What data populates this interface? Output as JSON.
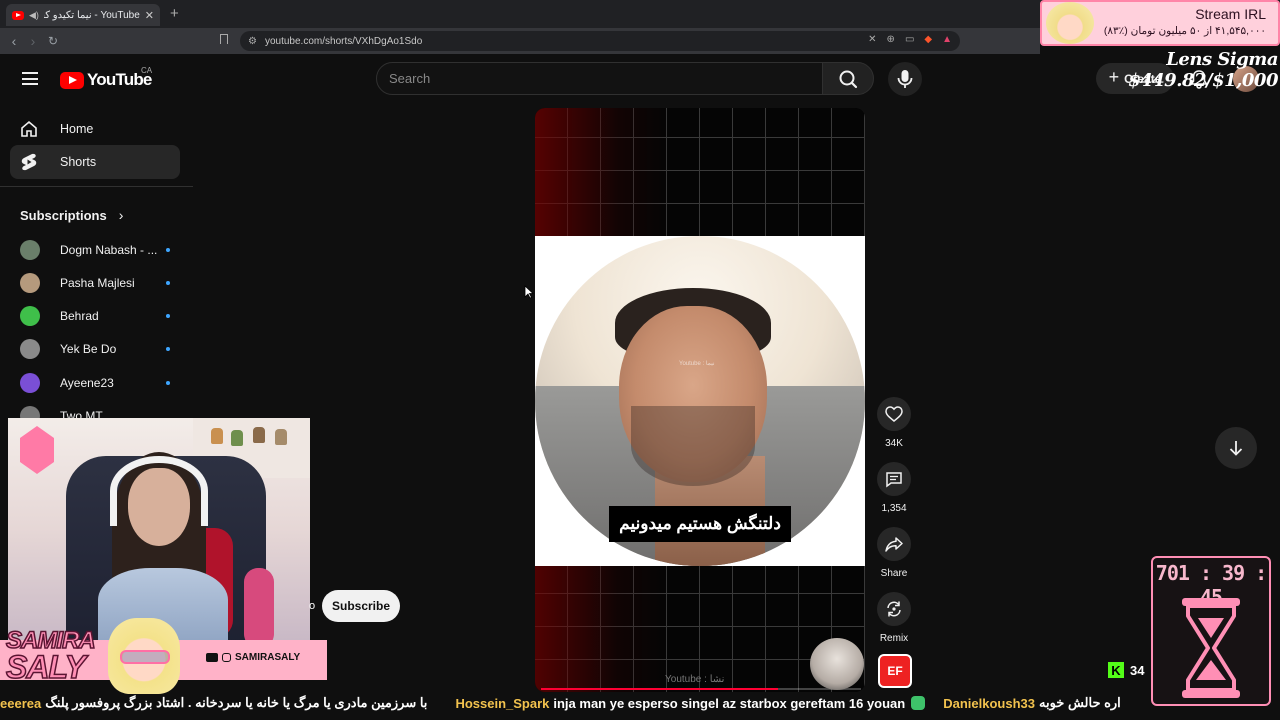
{
  "browser": {
    "tab_title": "YouTube - نیما تکیدو کجاس ؟",
    "url": "youtube.com/shorts/VXhDgAo1Sdo"
  },
  "masthead": {
    "logo_text": "YouTube",
    "country": "CA",
    "search_placeholder": "Search",
    "create_label": "Create"
  },
  "sidebar": {
    "items": [
      {
        "label": "Home",
        "icon": "home-icon"
      },
      {
        "label": "Shorts",
        "icon": "shorts-icon",
        "active": true
      }
    ],
    "subscriptions_heading": "Subscriptions",
    "subscriptions": [
      {
        "name": "Dogm Nabash - ...",
        "color": "#6a7f6a"
      },
      {
        "name": "Pasha Majlesi",
        "color": "#b59a7d"
      },
      {
        "name": "Behrad",
        "color": "#3fbf4a"
      },
      {
        "name": "Yek Be Do",
        "color": "#8a8a8a"
      },
      {
        "name": "Ayeene23",
        "color": "#7a4fd6"
      },
      {
        "name": "Two MT",
        "color": "#777777"
      }
    ]
  },
  "short": {
    "caption": "دلتنگش هستیم میدونیم",
    "watermark": "Youtube : نیما",
    "bottom_watermark": "Youtube : نشا",
    "progress": 0.74,
    "actions": {
      "likes": "34K",
      "comments": "1,354",
      "share": "Share",
      "remix": "Remix"
    },
    "sound_badge": "EF"
  },
  "stream": {
    "subscribe_label": "Subscribe",
    "subscribe_peek": "o",
    "brand_name_line1": "SAMIRA",
    "brand_name_line2": "SALY",
    "brand_handle": "SAMIRASALY",
    "donation_title": "Stream IRL",
    "donation_sub": "۴۱,۵۴۵,۰۰۰ از ۵۰ میلیون تومان (٪۸۳)",
    "goal": "Lens Sigma $449.82/$1,000",
    "timer": "701 : 39 : 45",
    "viewers": "34",
    "kick_letter": "K",
    "ticker": [
      {
        "user": "eeerea",
        "msg": "با سرزمین مادری یا مرگ یا خانه یا سردخانه . اشتاد بزرگ پروفسور پلنگ"
      },
      {
        "user": "Hossein_Spark",
        "msg": "inja man ye esperso singel az starbox gereftam 16 youan"
      },
      {
        "user": "Danielkoush33",
        "msg": "اره حالش خوبه"
      }
    ]
  },
  "colors": {
    "yt_red": "#ff0000",
    "progress_red": "#ff0033",
    "brand_pink": "#ff8fb5",
    "kick_green": "#53fc18",
    "username_gold": "#f2c24e"
  }
}
